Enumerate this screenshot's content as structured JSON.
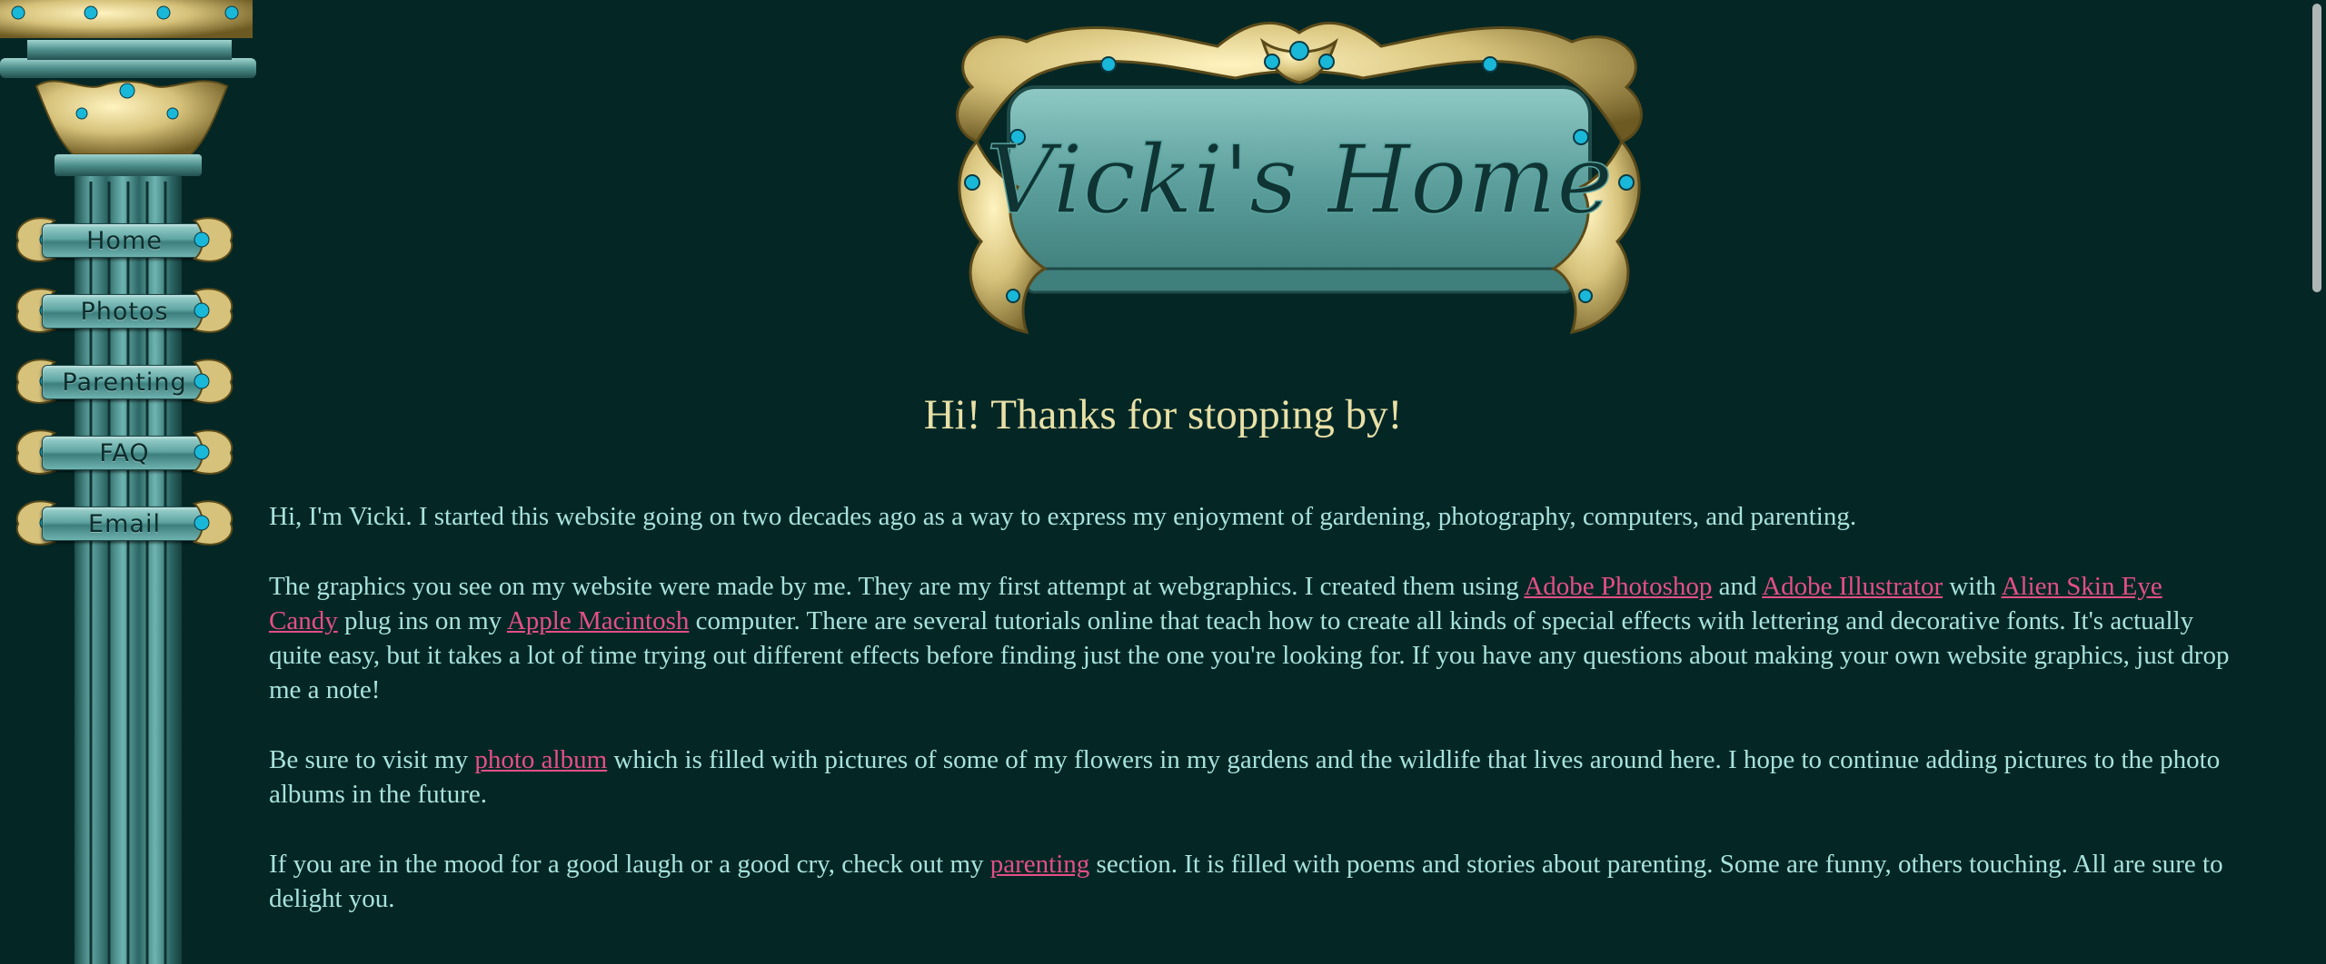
{
  "banner": {
    "text": "Vicki's Home"
  },
  "nav": {
    "items": [
      {
        "label": "Home"
      },
      {
        "label": "Photos"
      },
      {
        "label": "Parenting"
      },
      {
        "label": "FAQ"
      },
      {
        "label": "Email"
      }
    ]
  },
  "main": {
    "heading": "Hi! Thanks for stopping by!",
    "p1": "Hi, I'm Vicki. I started this website going on two decades ago as a way to express my enjoyment of gardening, photography, computers, and parenting.",
    "p2": {
      "t1": "The graphics you see on my website were made by me. They are my first attempt at webgraphics. I created them using ",
      "link1": "Adobe Photoshop",
      "t2": " and ",
      "link2": "Adobe Illustrator",
      "t3": " with ",
      "link3": "Alien Skin Eye Candy",
      "t4": " plug ins on my ",
      "link4": "Apple Macintosh",
      "t5": " computer. There are several tutorials online that teach how to create all kinds of special effects with lettering and decorative fonts. It's actually quite easy, but it takes a lot of time trying out different effects before finding just the one you're looking for. If you have any questions about making your own website graphics, just drop me a note!"
    },
    "p3": {
      "t1": "Be sure to visit my ",
      "link1": "photo album",
      "t2": " which is filled with pictures of some of my flowers in my gardens and the wildlife that lives around here. I hope to continue adding pictures to the photo albums in the future."
    },
    "p4": {
      "t1": "If you are in the mood for a good laugh or a good cry, check out my ",
      "link1": "parenting",
      "t2": " section. It is filled with poems and stories about parenting. Some are funny, others touching. All are sure to delight you."
    }
  },
  "colors": {
    "background": "#042726",
    "text": "#a9e2dc",
    "heading": "#e8e0a6",
    "link": "#e44f86",
    "gold": "#d6c27a",
    "teal": "#5fa5a2"
  }
}
